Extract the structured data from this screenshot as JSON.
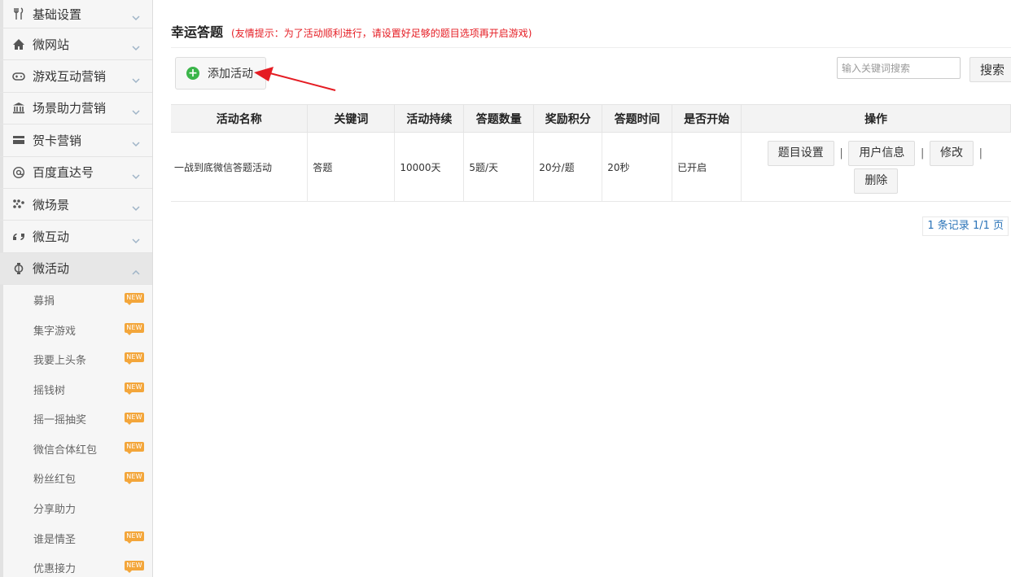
{
  "sidebar": {
    "items": [
      {
        "label": "基础设置",
        "icon": "utensils-icon",
        "expanded": false
      },
      {
        "label": "微网站",
        "icon": "home-icon",
        "expanded": false
      },
      {
        "label": "游戏互动营销",
        "icon": "gamepad-icon",
        "expanded": false
      },
      {
        "label": "场景助力营销",
        "icon": "bank-icon",
        "expanded": false
      },
      {
        "label": "贺卡营销",
        "icon": "card-icon",
        "expanded": false
      },
      {
        "label": "百度直达号",
        "icon": "at-icon",
        "expanded": false
      },
      {
        "label": "微场景",
        "icon": "grid-dots-icon",
        "expanded": false
      },
      {
        "label": "微互动",
        "icon": "quote-icon",
        "expanded": false
      },
      {
        "label": "微活动",
        "icon": "lantern-icon",
        "expanded": true
      }
    ],
    "sub_items": [
      {
        "label": "募捐",
        "badge": "NEW"
      },
      {
        "label": "集字游戏",
        "badge": "NEW"
      },
      {
        "label": "我要上头条",
        "badge": "NEW"
      },
      {
        "label": "摇钱树",
        "badge": "NEW"
      },
      {
        "label": "摇一摇抽奖",
        "badge": "NEW"
      },
      {
        "label": "微信合体红包",
        "badge": "NEW"
      },
      {
        "label": "粉丝红包",
        "badge": "NEW"
      },
      {
        "label": "分享助力",
        "badge": ""
      },
      {
        "label": "谁是情圣",
        "badge": "NEW"
      },
      {
        "label": "优惠接力",
        "badge": "NEW"
      }
    ]
  },
  "main": {
    "title": "幸运答题",
    "hint": "(友情提示：为了活动顺利进行，请设置好足够的题目选项再开启游戏)",
    "add_button": "添加活动",
    "search": {
      "placeholder": "输入关键词搜索",
      "value": "",
      "button": "搜索"
    },
    "table": {
      "headers": [
        "活动名称",
        "关键词",
        "活动持续",
        "答题数量",
        "奖励积分",
        "答题时间",
        "是否开始",
        "操作"
      ],
      "rows": [
        {
          "name": "一战到底微信答题活动",
          "keyword": "答题",
          "duration": "10000天",
          "count": "5题/天",
          "points": "20分/题",
          "time": "20秒",
          "started": "已开启",
          "ops": {
            "questions": "题目设置",
            "users": "用户信息",
            "edit": "修改",
            "delete": "删除",
            "separator": "|"
          }
        }
      ]
    },
    "pagination": "1 条记录 1/1 页"
  },
  "colors": {
    "accent_red": "#e51c23",
    "add_green": "#3bb54a",
    "badge_orange": "#f3a63b",
    "link_blue": "#2b74b8"
  }
}
